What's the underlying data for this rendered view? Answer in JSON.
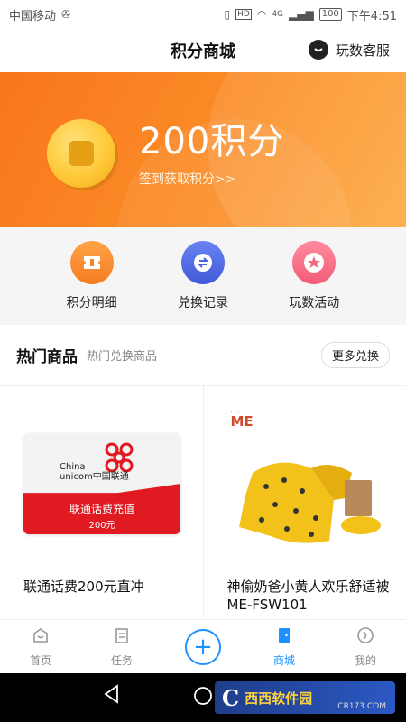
{
  "status_bar": {
    "carrier": "中国移动",
    "usb_icon": "usb-icon",
    "network": "4G",
    "battery": "100",
    "time": "下午4:51"
  },
  "header": {
    "title": "积分商城",
    "service_label": "玩数客服"
  },
  "banner": {
    "points": "200积分",
    "signin": "签到获取积分>>"
  },
  "quick_actions": [
    {
      "label": "积分明细",
      "icon": "ticket-icon"
    },
    {
      "label": "兑换记录",
      "icon": "exchange-icon"
    },
    {
      "label": "玩数活动",
      "icon": "star-icon"
    }
  ],
  "section": {
    "title": "热门商品",
    "subtitle": "热门兑换商品",
    "more": "更多兑换"
  },
  "products": [
    {
      "name": "联通话费200元直冲",
      "card_brand_en_1": "China",
      "card_brand_en_2": "unicom中国联通",
      "card_plan": "联通话费充值",
      "card_amount": "200元"
    },
    {
      "name": "神偷奶爸小黄人欢乐舒适被ME-FSW101",
      "logo_text": "ME"
    }
  ],
  "bottom_nav": [
    {
      "label": "首页",
      "icon": "home-icon",
      "active": false
    },
    {
      "label": "任务",
      "icon": "task-icon",
      "active": false
    },
    {
      "label": "",
      "icon": "plus-icon",
      "active": false
    },
    {
      "label": "商城",
      "icon": "store-icon",
      "active": true
    },
    {
      "label": "我的",
      "icon": "profile-icon",
      "active": false
    }
  ],
  "watermark": {
    "logo": "C",
    "text": "西西软件园",
    "url": "CR173.COM"
  },
  "colors": {
    "banner_orange": "#f9761d",
    "active_blue": "#1e90ff",
    "unicom_red": "#e11a22"
  }
}
